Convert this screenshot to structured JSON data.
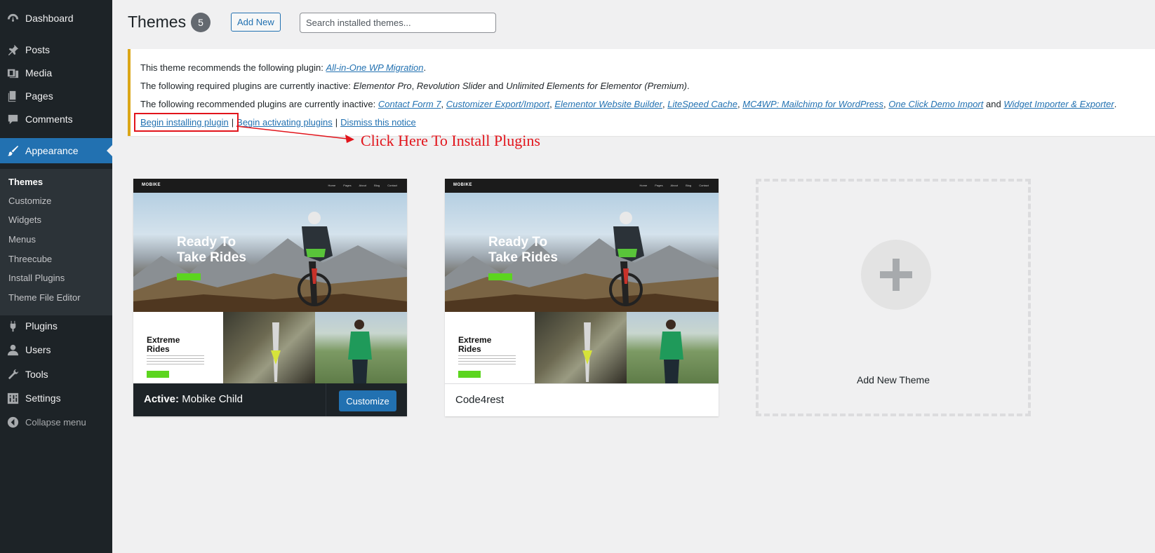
{
  "sidebar": {
    "menu": [
      {
        "label": "Dashboard",
        "icon": "dashboard-icon"
      },
      {
        "label": "Posts",
        "icon": "pin-icon"
      },
      {
        "label": "Media",
        "icon": "media-icon"
      },
      {
        "label": "Pages",
        "icon": "pages-icon"
      },
      {
        "label": "Comments",
        "icon": "comment-icon"
      },
      {
        "label": "Appearance",
        "icon": "brush-icon"
      },
      {
        "label": "Plugins",
        "icon": "plug-icon"
      },
      {
        "label": "Users",
        "icon": "user-icon"
      },
      {
        "label": "Tools",
        "icon": "wrench-icon"
      },
      {
        "label": "Settings",
        "icon": "sliders-icon"
      }
    ],
    "appearance_submenu": [
      "Themes",
      "Customize",
      "Widgets",
      "Menus",
      "Threecube",
      "Install Plugins",
      "Theme File Editor"
    ],
    "collapse_label": "Collapse menu",
    "accent_color": "#2271b1"
  },
  "header": {
    "title": "Themes",
    "count": "5",
    "add_new_label": "Add New",
    "search_placeholder": "Search installed themes..."
  },
  "notice": {
    "line1_prefix": "This theme recommends the following plugin:",
    "line1_plugin": "All-in-One WP Migration",
    "line2_prefix": "The following required plugins are currently inactive:",
    "line2_p1": "Elementor Pro",
    "line2_p2": "Revolution Slider",
    "line2_and": "and",
    "line2_p3": "Unlimited Elements for Elementor (Premium)",
    "line3_prefix": "The following recommended plugins are currently inactive:",
    "line3_plugins": [
      "Contact Form 7",
      "Customizer Export/Import",
      "Elementor Website Builder",
      "LiteSpeed Cache",
      "MC4WP: Mailchimp for WordPress",
      "One Click Demo Import"
    ],
    "line3_and": "and",
    "line3_last": "Widget Importer & Exporter",
    "actions": {
      "begin_installing": "Begin installing plugin",
      "begin_activating": "Begin activating plugins",
      "dismiss": "Dismiss this notice"
    },
    "border_color": "#dba617"
  },
  "annotation": {
    "callout_text": "Click Here To Install Plugins",
    "color": "#e2141b"
  },
  "themes": [
    {
      "active_prefix": "Active:",
      "name": "Mobike Child",
      "customize_label": "Customize",
      "screenshot": {
        "logo": "MOBIKE",
        "nav": "Home Pages About Blog Contact",
        "hero_title_1": "Ready To",
        "hero_title_2": "Take Rides",
        "lower_title_1": "Extreme",
        "lower_title_2": "Rides"
      }
    },
    {
      "name": "Code4rest",
      "screenshot": {
        "logo": "MOBIKE",
        "nav": "Home Pages About Blog Contact",
        "hero_title_1": "Ready To",
        "hero_title_2": "Take Rides",
        "lower_title_1": "Extreme",
        "lower_title_2": "Rides"
      }
    }
  ],
  "add_new_theme_label": "Add New Theme"
}
